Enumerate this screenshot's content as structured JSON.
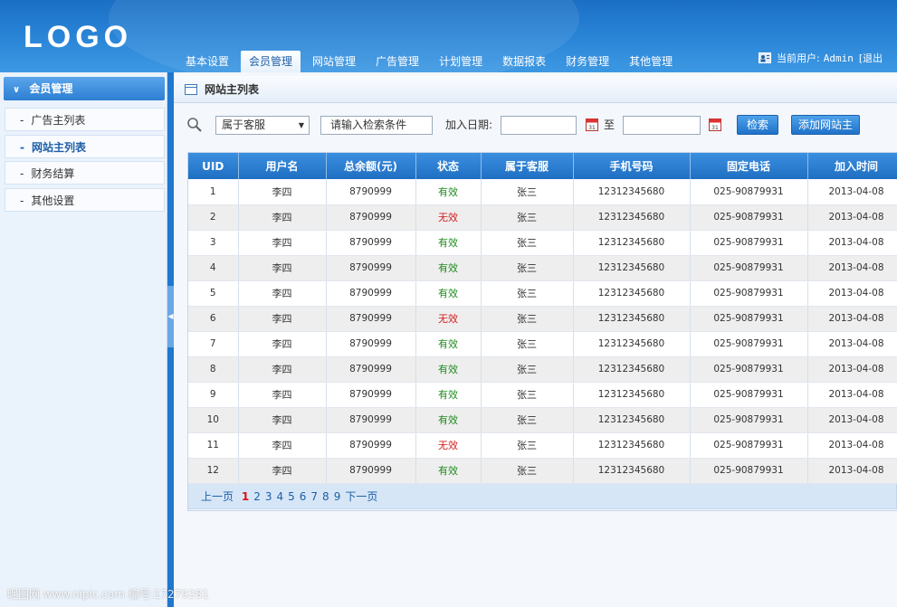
{
  "header": {
    "logo": "LOGO",
    "nav": [
      "基本设置",
      "会员管理",
      "网站管理",
      "广告管理",
      "计划管理",
      "数据报表",
      "财务管理",
      "其他管理"
    ],
    "active_nav_index": 1,
    "user_label": "当前用户:",
    "user_name": "Admin",
    "logout_label": "[退出"
  },
  "sidebar": {
    "section_title": "会员管理",
    "items": [
      {
        "label": "广告主列表"
      },
      {
        "label": "网站主列表"
      },
      {
        "label": "财务结算"
      },
      {
        "label": "其他设置"
      }
    ],
    "active_index": 1
  },
  "main": {
    "title": "网站主列表",
    "search": {
      "select_value": "属于客服",
      "input_value": "请输入检索条件",
      "date_label": "加入日期:",
      "to_label": "至",
      "search_button": "检索",
      "add_button": "添加网站主"
    },
    "table": {
      "columns": [
        "UID",
        "用户名",
        "总余额(元)",
        "状态",
        "属于客服",
        "手机号码",
        "固定电话",
        "加入时间"
      ],
      "rows": [
        [
          "1",
          "李四",
          "8790999",
          "有效",
          "张三",
          "12312345680",
          "025-90879931",
          "2013-04-08"
        ],
        [
          "2",
          "李四",
          "8790999",
          "无效",
          "张三",
          "12312345680",
          "025-90879931",
          "2013-04-08"
        ],
        [
          "3",
          "李四",
          "8790999",
          "有效",
          "张三",
          "12312345680",
          "025-90879931",
          "2013-04-08"
        ],
        [
          "4",
          "李四",
          "8790999",
          "有效",
          "张三",
          "12312345680",
          "025-90879931",
          "2013-04-08"
        ],
        [
          "5",
          "李四",
          "8790999",
          "有效",
          "张三",
          "12312345680",
          "025-90879931",
          "2013-04-08"
        ],
        [
          "6",
          "李四",
          "8790999",
          "无效",
          "张三",
          "12312345680",
          "025-90879931",
          "2013-04-08"
        ],
        [
          "7",
          "李四",
          "8790999",
          "有效",
          "张三",
          "12312345680",
          "025-90879931",
          "2013-04-08"
        ],
        [
          "8",
          "李四",
          "8790999",
          "有效",
          "张三",
          "12312345680",
          "025-90879931",
          "2013-04-08"
        ],
        [
          "9",
          "李四",
          "8790999",
          "有效",
          "张三",
          "12312345680",
          "025-90879931",
          "2013-04-08"
        ],
        [
          "10",
          "李四",
          "8790999",
          "有效",
          "张三",
          "12312345680",
          "025-90879931",
          "2013-04-08"
        ],
        [
          "11",
          "李四",
          "8790999",
          "无效",
          "张三",
          "12312345680",
          "025-90879931",
          "2013-04-08"
        ],
        [
          "12",
          "李四",
          "8790999",
          "有效",
          "张三",
          "12312345680",
          "025-90879931",
          "2013-04-08"
        ]
      ]
    },
    "pager": {
      "prev": "上一页",
      "pages": [
        "1",
        "2",
        "3",
        "4",
        "5",
        "6",
        "7",
        "8",
        "9"
      ],
      "current": "1",
      "next": "下一页"
    }
  },
  "watermark": "昵图网 www.nipic.com  编号:17279281",
  "colors": {
    "header_blue": "#2b86d8",
    "valid_green": "#1e8a1e",
    "invalid_red": "#d11d1d",
    "page_current_red": "#e01010"
  }
}
